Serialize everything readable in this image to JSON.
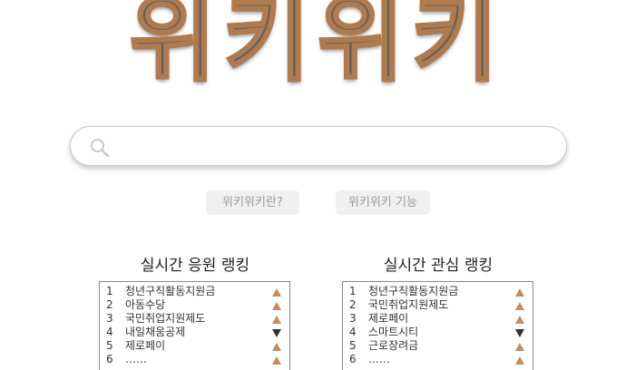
{
  "logo": {
    "text": "위키위키"
  },
  "search": {
    "value": "",
    "placeholder": "",
    "icon": "search-icon"
  },
  "buttons": {
    "what_is": "위키위키란?",
    "features": "위키위키 기능"
  },
  "support_ranking": {
    "title": "실시간 응원 랭킹",
    "items": [
      {
        "rank": "1",
        "name": "청년구직활동지원금",
        "trend": "up"
      },
      {
        "rank": "2",
        "name": "아동수당",
        "trend": "up"
      },
      {
        "rank": "3",
        "name": "국민취업지원제도",
        "trend": "up"
      },
      {
        "rank": "4",
        "name": "내일채움공제",
        "trend": "down"
      },
      {
        "rank": "5",
        "name": "제로페이",
        "trend": "up"
      },
      {
        "rank": "6",
        "name": "……",
        "trend": "up"
      }
    ]
  },
  "interest_ranking": {
    "title": "실시간 관심 랭킹",
    "items": [
      {
        "rank": "1",
        "name": "청년구직활동지원금",
        "trend": "up"
      },
      {
        "rank": "2",
        "name": "국민취업지원제도",
        "trend": "up"
      },
      {
        "rank": "3",
        "name": "제로페이",
        "trend": "up"
      },
      {
        "rank": "4",
        "name": "스마트시티",
        "trend": "down"
      },
      {
        "rank": "5",
        "name": "근로장려금",
        "trend": "up"
      },
      {
        "rank": "6",
        "name": "……",
        "trend": "up"
      }
    ]
  },
  "colors": {
    "up_arrow": "#c58c5c",
    "down_arrow": "#333333",
    "logo_outline": "#b07a4f"
  }
}
